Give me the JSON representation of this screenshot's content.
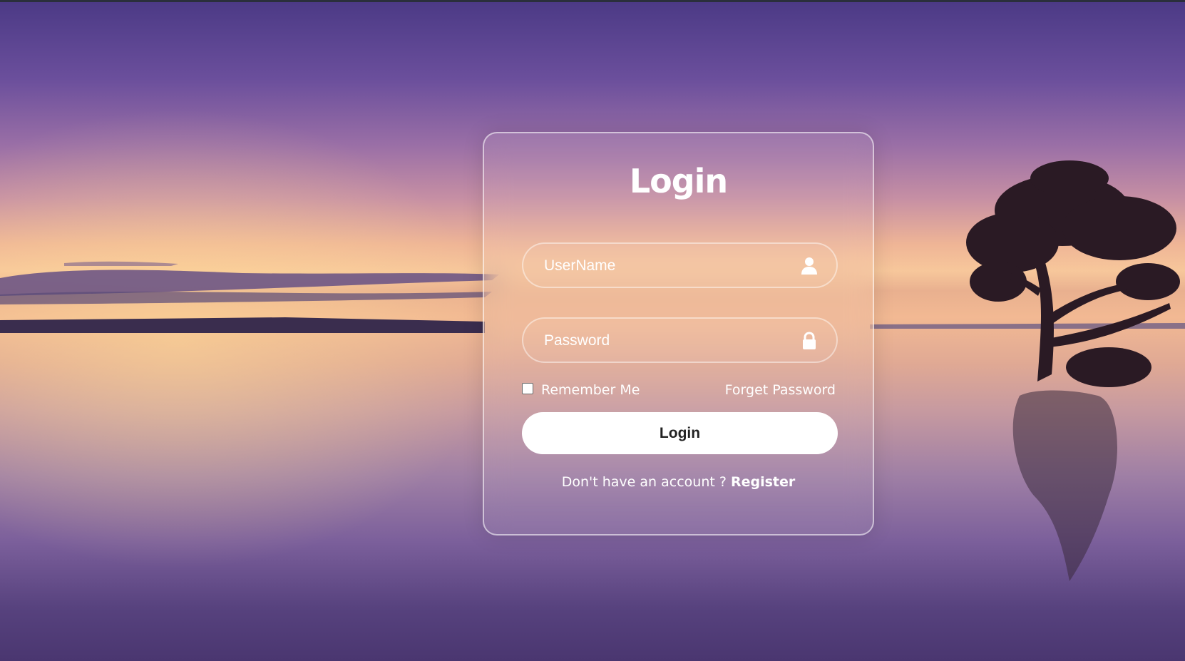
{
  "form": {
    "title": "Login",
    "username": {
      "placeholder": "UserName",
      "value": "",
      "icon": "user-icon"
    },
    "password": {
      "placeholder": "Password",
      "value": "",
      "icon": "lock-icon"
    },
    "remember_label": "Remember Me",
    "remember_checked": false,
    "forgot_label": "Forget Password",
    "submit_label": "Login",
    "register_prompt": "Don't have an account ? ",
    "register_label": "Register"
  },
  "colors": {
    "text": "#ffffff",
    "button_bg": "#ffffff",
    "button_text": "#222222"
  }
}
